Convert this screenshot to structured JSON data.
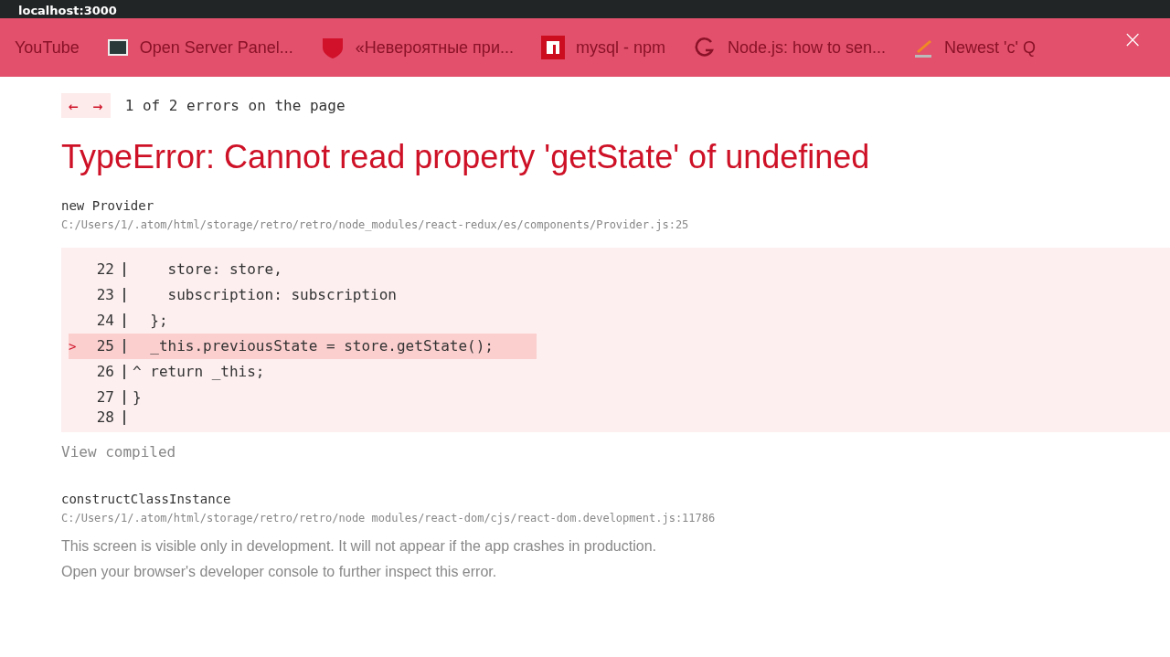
{
  "address_bar": {
    "url": "localhost:3000"
  },
  "bookmarks": [
    {
      "label": "YouTube"
    },
    {
      "label": "Open Server Panel..."
    },
    {
      "label": "«Невероятные при..."
    },
    {
      "label": "mysql - npm"
    },
    {
      "label": "Node.js: how to sen..."
    },
    {
      "label": "Newest 'c' Q"
    }
  ],
  "overlay_close": "×",
  "error_nav": {
    "prev": "←",
    "next": "→",
    "counter": "1 of 2 errors on the page"
  },
  "error_title": "TypeError: Cannot read property 'getState' of undefined",
  "frames": [
    {
      "function": "new Provider",
      "file": "C:/Users/1/.atom/html/storage/retro/retro/node_modules/react-redux/es/components/Provider.js:25",
      "code": [
        {
          "number": "22",
          "code": "    store: store,",
          "highlighted": false
        },
        {
          "number": "23",
          "code": "    subscription: subscription",
          "highlighted": false
        },
        {
          "number": "24",
          "code": "  };",
          "highlighted": false
        },
        {
          "number": "25",
          "marker": ">",
          "code": "  _this.previousState = store.getState();",
          "highlighted": true
        },
        {
          "number": "26",
          "code": "^ return _this;",
          "highlighted": false
        },
        {
          "number": "27",
          "code": "}",
          "highlighted": false
        },
        {
          "number": "28",
          "highlighted": false
        }
      ],
      "view_compiled": "View compiled"
    },
    {
      "function": "constructClassInstance",
      "file": "C:/Users/1/.atom/html/storage/retro/retro/node modules/react-dom/cjs/react-dom.development.js:11786"
    }
  ],
  "footer": [
    "This screen is visible only in development. It will not appear if the app crashes in production.",
    "Open your browser's developer console to further inspect this error."
  ]
}
